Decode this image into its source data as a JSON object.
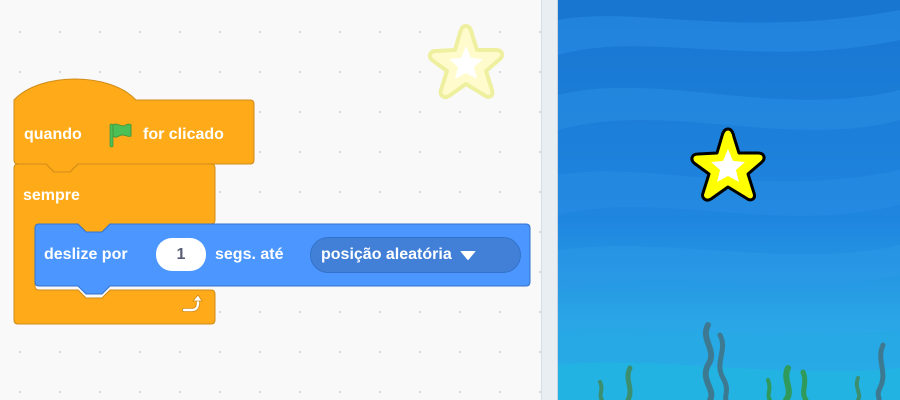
{
  "code_area": {
    "hat_block": {
      "text_before": "quando",
      "flag_icon": "green-flag-icon",
      "text_after": "for clicado",
      "color": "#ffab19"
    },
    "forever_block": {
      "label": "sempre",
      "loop_icon": "loop-arrow-icon",
      "color": "#ffab19"
    },
    "glide_block": {
      "text_before": "deslize por",
      "seconds_value": "1",
      "text_middle": "segs. até",
      "target_option": "posição aleatória",
      "dropdown_icon": "dropdown-arrow-icon",
      "color": "#4c97ff"
    }
  },
  "sprite_preview": {
    "icon": "star-sprite-icon",
    "color": "#fff9c4"
  },
  "stage": {
    "backdrop": "underwater",
    "sprite_icon": "star-sprite-icon",
    "sprite_color": "#ffff00",
    "background_color": "#1e7fd9"
  }
}
